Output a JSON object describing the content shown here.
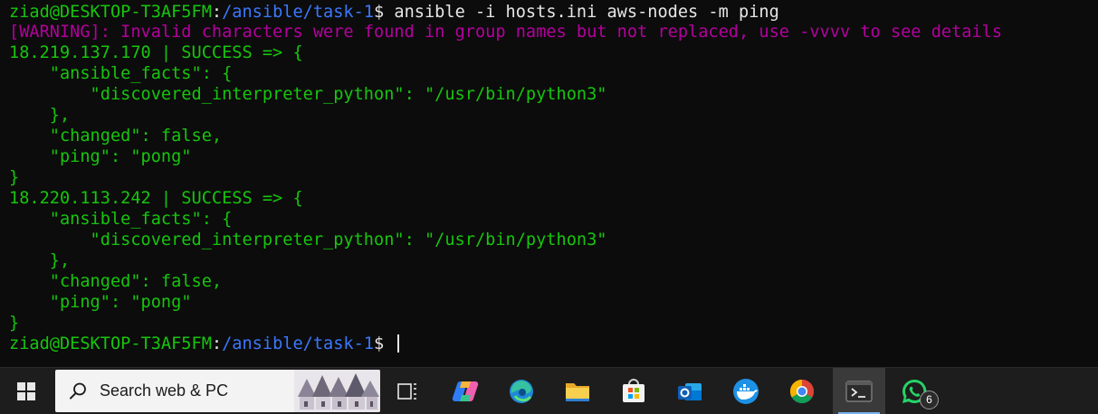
{
  "terminal": {
    "prompt_user_host": "ziad@DESKTOP-T3AF5FM",
    "prompt_colon": ":",
    "prompt_path": "/ansible/task-1",
    "prompt_symbol": "$ ",
    "command": "ansible -i hosts.ini aws-nodes -m ping",
    "warning": "[WARNING]: Invalid characters were found in group names but not replaced, use -vvvv to see details",
    "output_lines": [
      "18.219.137.170 | SUCCESS => {",
      "    \"ansible_facts\": {",
      "        \"discovered_interpreter_python\": \"/usr/bin/python3\"",
      "    },",
      "    \"changed\": false,",
      "    \"ping\": \"pong\"",
      "}",
      "18.220.113.242 | SUCCESS => {",
      "    \"ansible_facts\": {",
      "        \"discovered_interpreter_python\": \"/usr/bin/python3\"",
      "    },",
      "    \"changed\": false,",
      "    \"ping\": \"pong\"",
      "}"
    ],
    "colors": {
      "background": "#0c0c0c",
      "green": "#16c60c",
      "blue": "#3b78ff",
      "magenta": "#b4009e"
    }
  },
  "taskbar": {
    "search_placeholder": "Search web & PC",
    "whatsapp_badge": "6",
    "icons": [
      "windows-start-icon",
      "search-icon",
      "task-view-icon",
      "copilot-icon",
      "edge-icon",
      "file-explorer-icon",
      "microsoft-store-icon",
      "outlook-icon",
      "docker-icon",
      "chrome-icon",
      "terminal-icon",
      "whatsapp-icon"
    ]
  }
}
